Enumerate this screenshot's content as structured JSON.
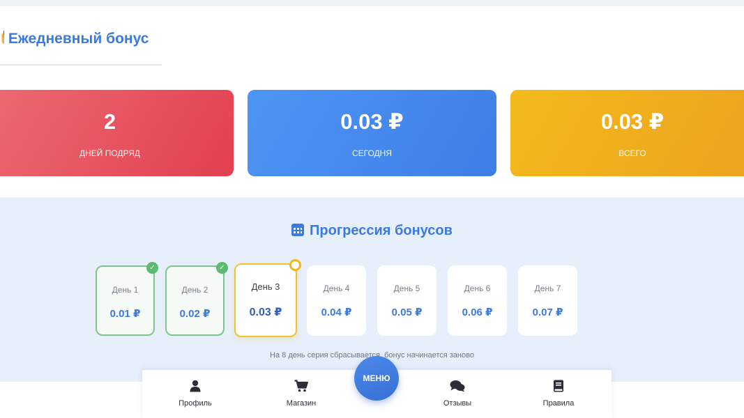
{
  "header": {
    "gift_glyph": "🎁",
    "title": "Ежедневный бонус"
  },
  "stats": [
    {
      "value": "2",
      "label": "ДНЕЙ ПОДРЯД"
    },
    {
      "value": "0.03 ₽",
      "label": "СЕГОДНЯ"
    },
    {
      "value": "0.03 ₽",
      "label": "ВСЕГО"
    }
  ],
  "progression": {
    "title": "Прогрессия бонусов",
    "days": [
      {
        "name": "День 1",
        "amount": "0.01 ₽",
        "state": "done"
      },
      {
        "name": "День 2",
        "amount": "0.02 ₽",
        "state": "done"
      },
      {
        "name": "День 3",
        "amount": "0.03 ₽",
        "state": "current"
      },
      {
        "name": "День 4",
        "amount": "0.04 ₽",
        "state": "upcoming"
      },
      {
        "name": "День 5",
        "amount": "0.05 ₽",
        "state": "upcoming"
      },
      {
        "name": "День 6",
        "amount": "0.06 ₽",
        "state": "upcoming"
      },
      {
        "name": "День 7",
        "amount": "0.07 ₽",
        "state": "upcoming"
      }
    ],
    "note": "На 8 день серия сбрасывается, бонус начинается заново"
  },
  "nav": {
    "items": [
      {
        "label": "Профиль",
        "icon": "user-icon"
      },
      {
        "label": "Магазин",
        "icon": "cart-icon"
      },
      {
        "label": "Отзывы",
        "icon": "comments-icon"
      },
      {
        "label": "Правила",
        "icon": "book-icon"
      }
    ],
    "menu_label": "МЕНЮ"
  },
  "colors": {
    "accent": "#3b7ae0",
    "streak": "#e2404f",
    "today": "#3f7ee6",
    "total": "#eca21f",
    "done": "#5cbb71",
    "current": "#f2c12e"
  }
}
